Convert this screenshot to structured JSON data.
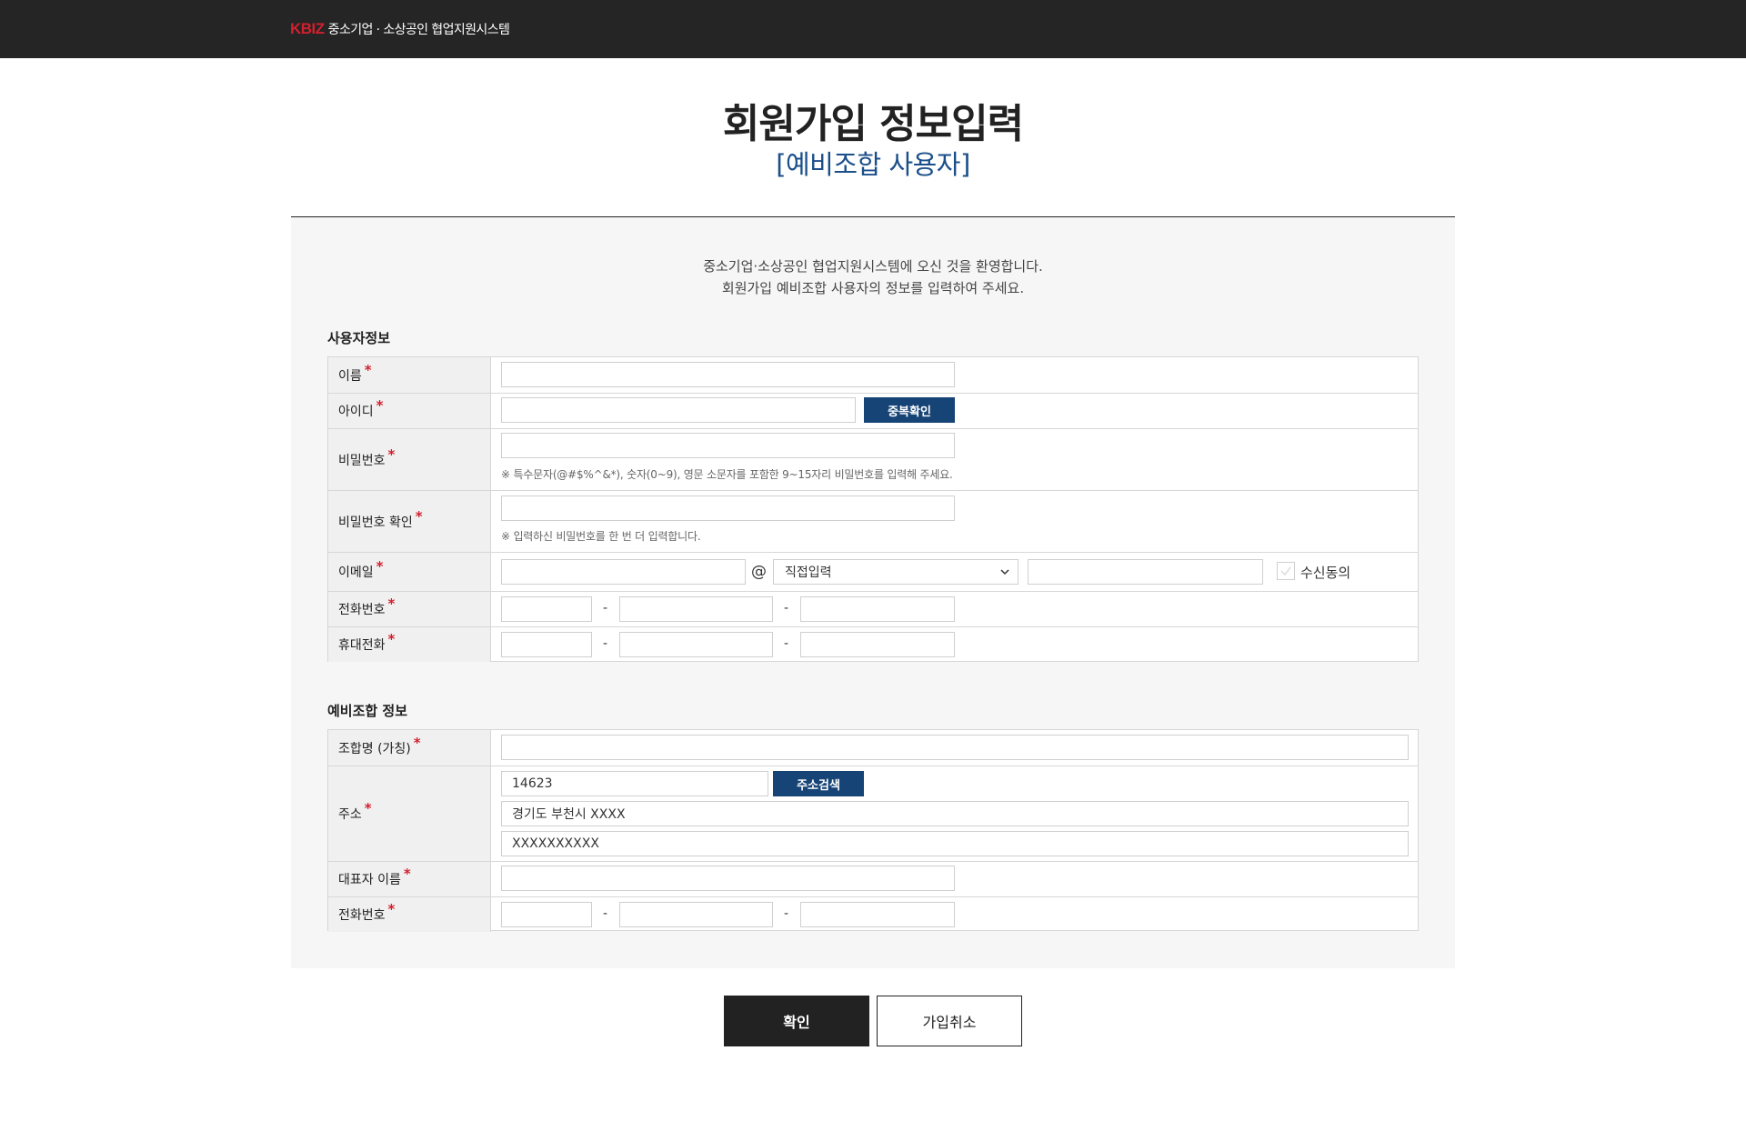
{
  "header": {
    "logo_mark": "KBIZ",
    "system_name": "중소기업 · 소상공인 협업지원시스템"
  },
  "page": {
    "title": "회원가입 정보입력",
    "subtitle": "[예비조합 사용자]",
    "intro_line1": "중소기업·소상공인 협업지원시스템에 오신 것을 환영합니다.",
    "intro_line2": "회원가입 예비조합 사용자의 정보를 입력하여 주세요."
  },
  "user_info": {
    "section_title": "사용자정보",
    "name_label": "이름",
    "name_value": "",
    "id_label": "아이디",
    "id_value": "",
    "dup_check_button": "중복확인",
    "password_label": "비밀번호",
    "password_value": "",
    "password_hint": "※ 특수문자(@#$%^&*), 숫자(0~9), 영문 소문자를 포함한 9~15자리 비밀번호를 입력해 주세요.",
    "password_confirm_label": "비밀번호 확인",
    "password_confirm_value": "",
    "password_confirm_hint": "※ 입력하신 비밀번호를 한 번 더 입력합니다.",
    "email_label": "이메일",
    "email_local": "",
    "email_at": "@",
    "email_domain_select": "직접입력",
    "email_domain_value": "",
    "email_consent_label": "수신동의",
    "email_consent_checked": false,
    "phone_label": "전화번호",
    "mobile_label": "휴대전화",
    "dash": "-"
  },
  "union_info": {
    "section_title": "예비조합 정보",
    "union_name_label": "조합명 (가칭)",
    "union_name_value": "",
    "address_label": "주소",
    "zipcode": "14623",
    "address_search_button": "주소검색",
    "address_line1": "경기도 부천시 XXXX",
    "address_line2": "XXXXXXXXXX",
    "rep_name_label": "대표자 이름",
    "rep_name_value": "",
    "phone_label": "전화번호"
  },
  "actions": {
    "confirm": "확인",
    "cancel": "가입취소"
  },
  "colors": {
    "topbar": "#252525",
    "brand_red": "#d2202e",
    "accent_blue": "#174476",
    "subtitle_blue": "#1b4f8a"
  }
}
